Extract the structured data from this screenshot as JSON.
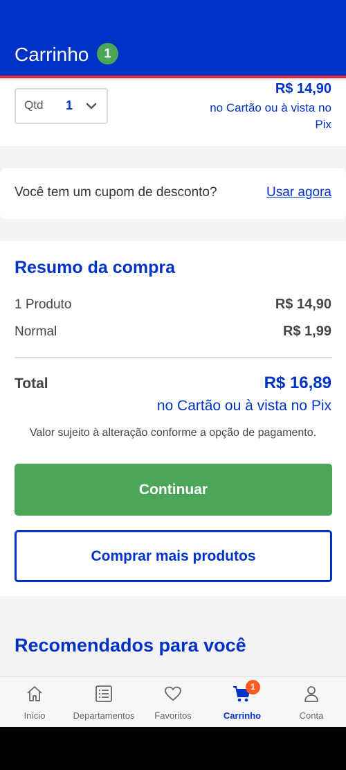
{
  "header": {
    "title": "Carrinho",
    "count_badge": "1",
    "colors": {
      "background": "#0033c5",
      "stripe": "#e8253a",
      "badge": "#4ca65a"
    }
  },
  "item": {
    "qty_label": "Qtd",
    "qty_value": "1",
    "price": "R$ 14,90",
    "payment_line": "no Cartão ou à vista no Pix"
  },
  "coupon": {
    "question": "Você tem um cupom de desconto?",
    "link": "Usar agora"
  },
  "summary": {
    "title": "Resumo da compra",
    "rows": [
      {
        "label": "1 Produto",
        "value": "R$ 14,90"
      },
      {
        "label": "Normal",
        "value": "R$ 1,99"
      }
    ],
    "total_label": "Total",
    "total_value": "R$ 16,89",
    "total_payment_line": "no Cartão ou à vista no Pix",
    "note": "Valor sujeito à alteração conforme a opção de pagamento.",
    "continue_button": "Continuar",
    "more_products_button": "Comprar mais produtos"
  },
  "recommendations": {
    "title": "Recomendados para você"
  },
  "bottom_nav": {
    "items": [
      {
        "label": "Início",
        "icon": "home-icon"
      },
      {
        "label": "Departamentos",
        "icon": "list-icon"
      },
      {
        "label": "Favoritos",
        "icon": "heart-icon"
      },
      {
        "label": "Carrinho",
        "icon": "cart-icon",
        "active": true,
        "badge": "1"
      },
      {
        "label": "Conta",
        "icon": "user-icon"
      }
    ]
  },
  "colors": {
    "primary": "#0033c5",
    "success": "#4ca65a",
    "cart_badge": "#ff5a1f"
  }
}
